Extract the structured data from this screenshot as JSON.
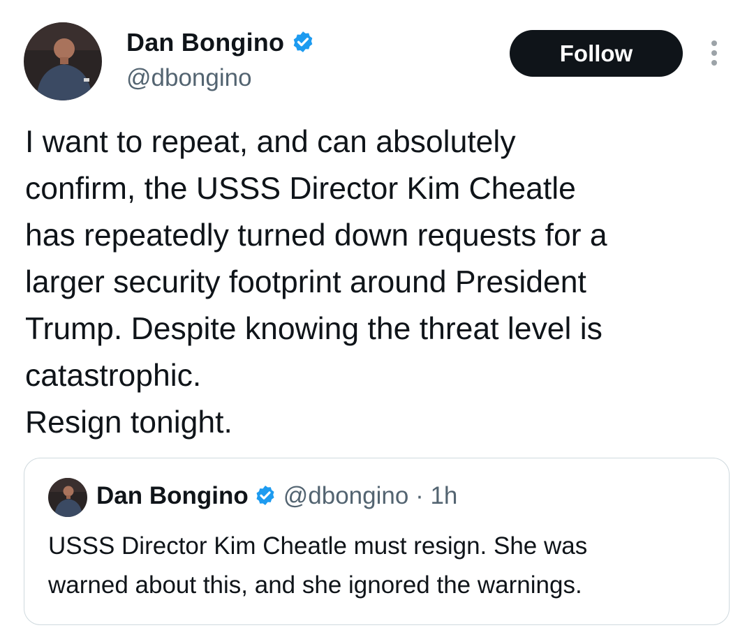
{
  "tweet": {
    "author": {
      "name": "Dan Bongino",
      "handle": "@dbongino",
      "verified_icon": "verified-badge-icon",
      "verified_color": "#1d9bf0"
    },
    "follow_label": "Follow",
    "more_icon": "more-vertical-icon",
    "text_lines": [
      "I want to repeat, and can absolutely",
      "confirm, the USSS Director Kim Cheatle",
      "has repeatedly turned down requests for a",
      "larger security footprint around President",
      "Trump. Despite knowing the threat level is",
      "catastrophic.",
      "Resign tonight."
    ]
  },
  "quoted_tweet": {
    "author": {
      "name": "Dan Bongino",
      "handle": "@dbongino",
      "verified_icon": "verified-badge-icon"
    },
    "separator": "·",
    "time": "1h",
    "text_lines": [
      "USSS Director Kim Cheatle must resign. She was",
      "warned about this, and she ignored the warnings."
    ]
  },
  "colors": {
    "text": "#0f1419",
    "secondary_text": "#536471",
    "follow_bg": "#0f1419",
    "follow_text": "#ffffff",
    "border": "#cfd9de"
  }
}
